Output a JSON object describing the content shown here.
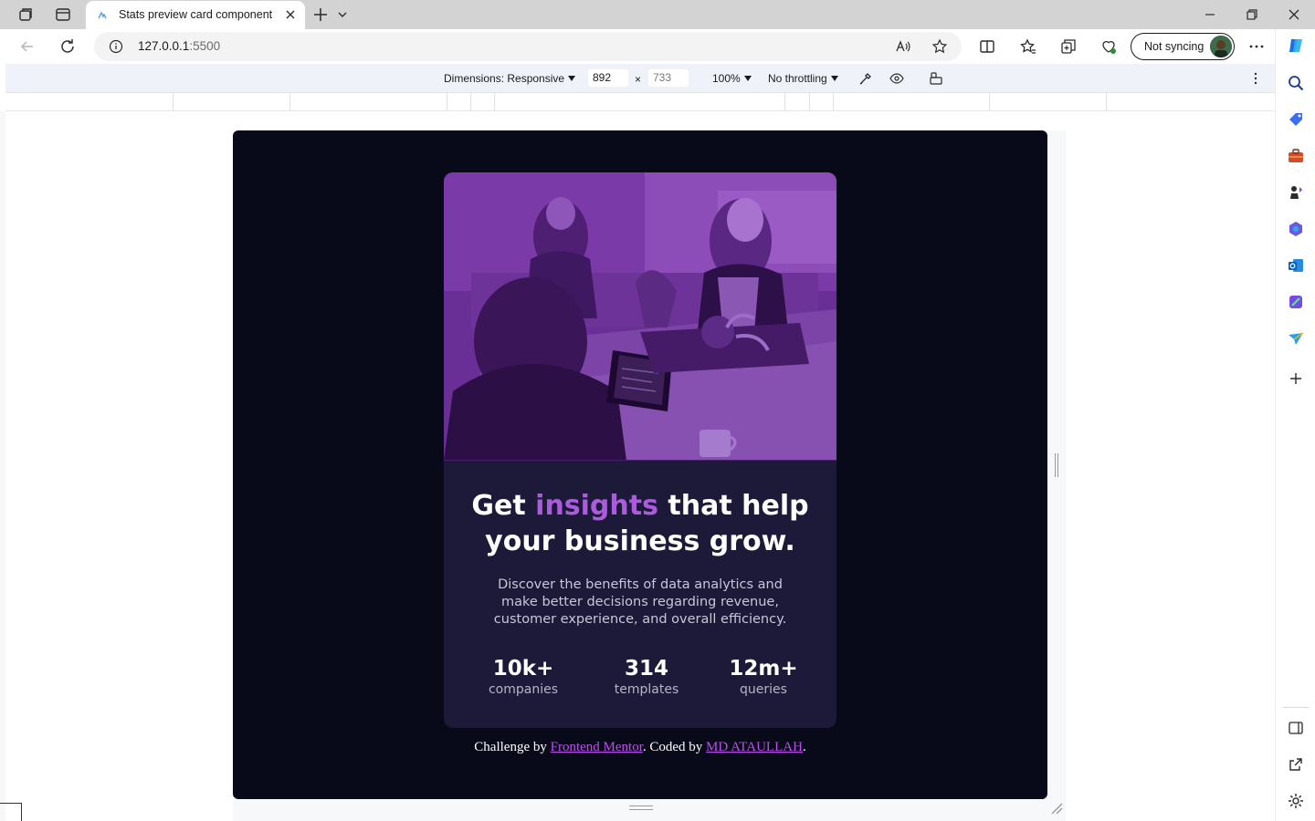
{
  "browser": {
    "tab": {
      "title": "Stats preview card component"
    },
    "address": {
      "host": "127.0.0.1",
      "port": ":5500"
    },
    "sync_label": "Not syncing"
  },
  "devtools": {
    "dimensions_label": "Dimensions: Responsive",
    "width": "892",
    "times": "×",
    "height_placeholder": "733",
    "zoom": "100%",
    "throttling": "No throttling"
  },
  "card": {
    "heading_pre": "Get ",
    "heading_accent": "insights",
    "heading_post": " that help your business grow.",
    "description": "Discover the benefits of data analytics and make better decisions regarding revenue, customer experience, and overall efficiency.",
    "stats": [
      {
        "value": "10k+",
        "label": "companies"
      },
      {
        "value": "314",
        "label": "templates"
      },
      {
        "value": "12m+",
        "label": "queries"
      }
    ]
  },
  "attribution": {
    "prefix": "Challenge by ",
    "link1": "Frontend Mentor",
    "middle": ". Coded by ",
    "link2": "MD ATAULLAH",
    "suffix": "."
  },
  "colors": {
    "page_bg": "#080a1a",
    "card_bg": "#1c1939",
    "image_tint": "#6b2f99",
    "accent": "#aa5cdb",
    "link": "#c04bf0"
  }
}
